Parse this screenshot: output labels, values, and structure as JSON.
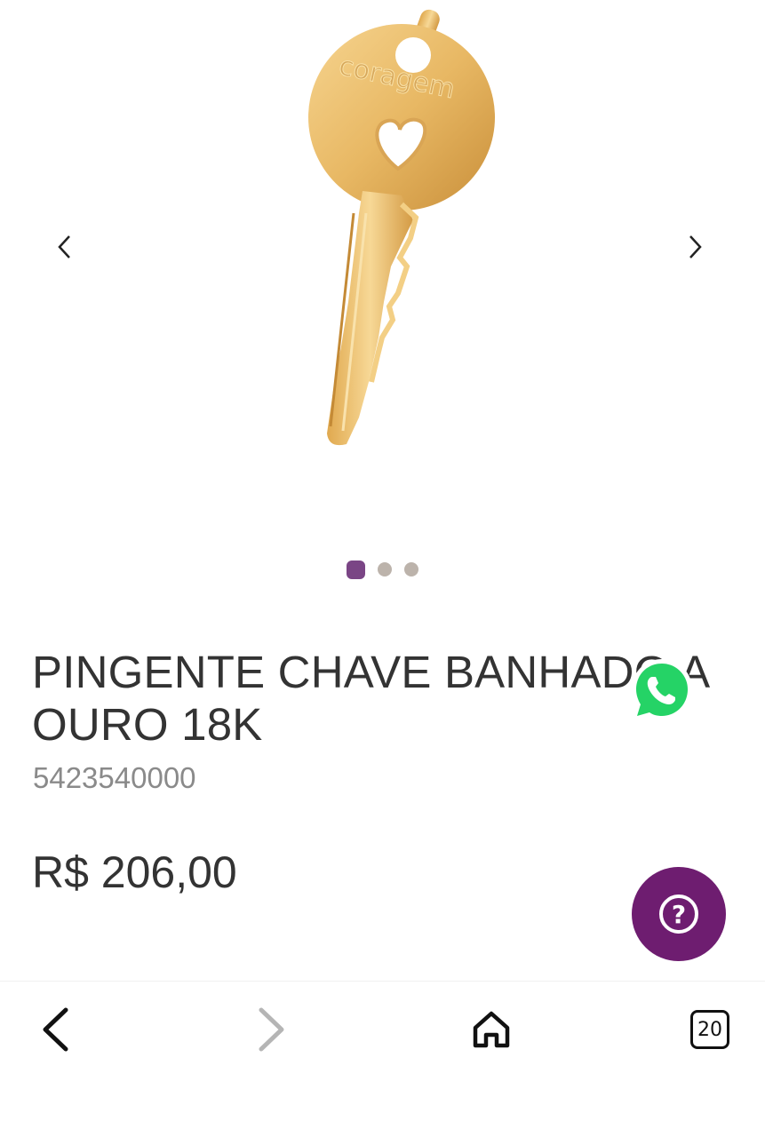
{
  "carousel": {
    "image_text": "coragem",
    "prev_icon": "chevron-left-icon",
    "next_icon": "chevron-right-icon",
    "slide_count": 3,
    "active_slide": 1,
    "active_color": "#7a4585",
    "inactive_color": "#bcb3ab"
  },
  "product": {
    "title": "PINGENTE CHAVE BANHADO A OURO 18K",
    "sku": "5423540000",
    "price": "R$ 206,00"
  },
  "floating": {
    "whatsapp_icon": "whatsapp-icon",
    "whatsapp_color": "#25d366",
    "help_icon": "question-icon",
    "help_label": "?",
    "help_color": "#6e1d70"
  },
  "browser_bar": {
    "back_icon": "back-arrow-icon",
    "forward_icon": "forward-arrow-icon",
    "home_icon": "home-icon",
    "tabs_count": "20"
  }
}
